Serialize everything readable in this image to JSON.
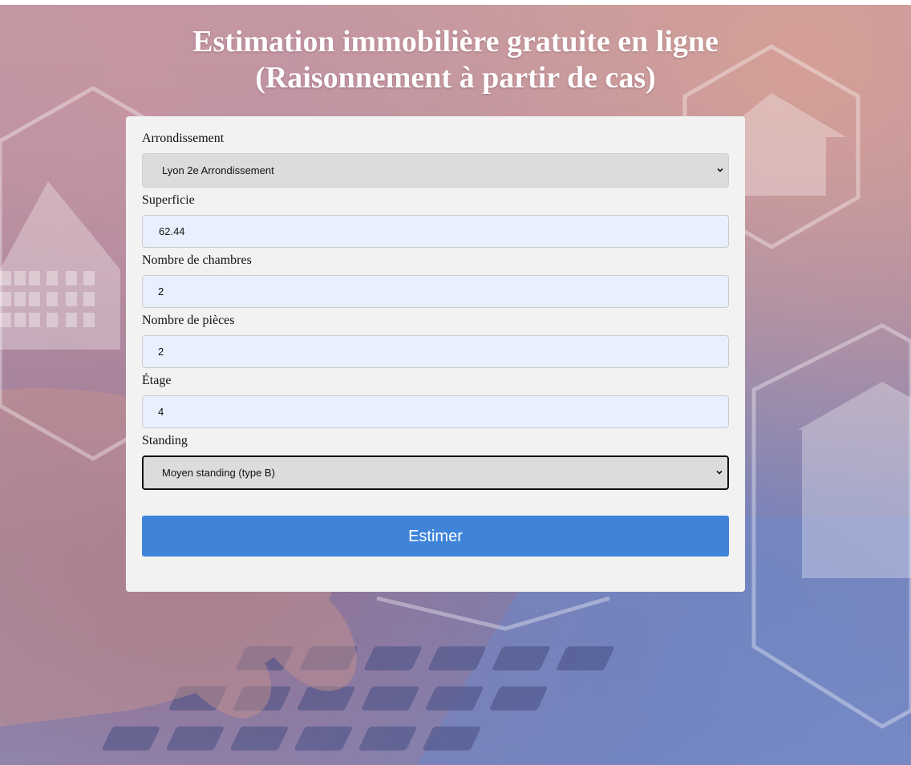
{
  "page": {
    "title_line1": "Estimation immobilière gratuite en ligne",
    "title_line2": "(Raisonnement à partir de cas)"
  },
  "form": {
    "arrondissement": {
      "label": "Arrondissement",
      "selected": "Lyon 2e Arrondissement"
    },
    "superficie": {
      "label": "Superficie",
      "value": "62.44"
    },
    "chambres": {
      "label": "Nombre de chambres",
      "value": "2"
    },
    "pieces": {
      "label": "Nombre de pièces",
      "value": "2"
    },
    "etage": {
      "label": "Étage",
      "value": "4"
    },
    "standing": {
      "label": "Standing",
      "selected": "Moyen standing (type B)"
    },
    "submit_label": "Estimer"
  },
  "colors": {
    "button": "#3f84d9",
    "input_autofill": "#e8f0fe",
    "card": "#f2f2f2"
  }
}
